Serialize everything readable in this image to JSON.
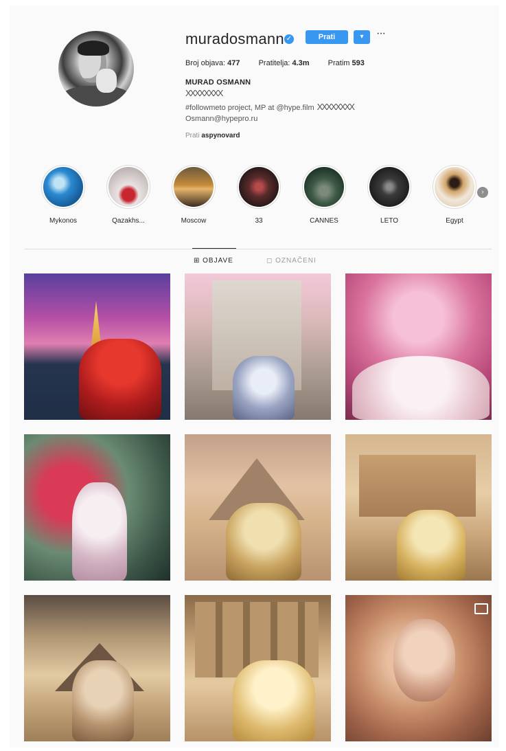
{
  "profile": {
    "username": "muradosmann",
    "follow_label": "Prati",
    "more_label": "▾",
    "options_label": "···",
    "posts_label": "Broj objava:",
    "posts_count": "477",
    "followers_label": "Pratitelja:",
    "followers_count": "4.3m",
    "following_label": "Pratim",
    "following_count": "593",
    "full_name": "MURAD OSMANN",
    "bio_line1": "XXXXXXXX",
    "bio_line2": "#followmeto project, MP at @hype.film",
    "bio_line2_x": "XXXXXXXX",
    "email": "Osmann@hypepro.ru",
    "followed_by_label": "Prati",
    "followed_by_user": "aspynovard"
  },
  "highlights": [
    {
      "label": "Mykonos"
    },
    {
      "label": "Qazakhs..."
    },
    {
      "label": "Moscow"
    },
    {
      "label": "33"
    },
    {
      "label": "CANNES"
    },
    {
      "label": "LETO"
    },
    {
      "label": "Egypt"
    }
  ],
  "tabs": {
    "posts": "⊞ OBJAVE",
    "tagged": "◻ OZNAČENI"
  },
  "colors": {
    "accent": "#3897f0",
    "text": "#262626",
    "muted": "#8e8e8e",
    "divider": "#dbdbdb"
  }
}
